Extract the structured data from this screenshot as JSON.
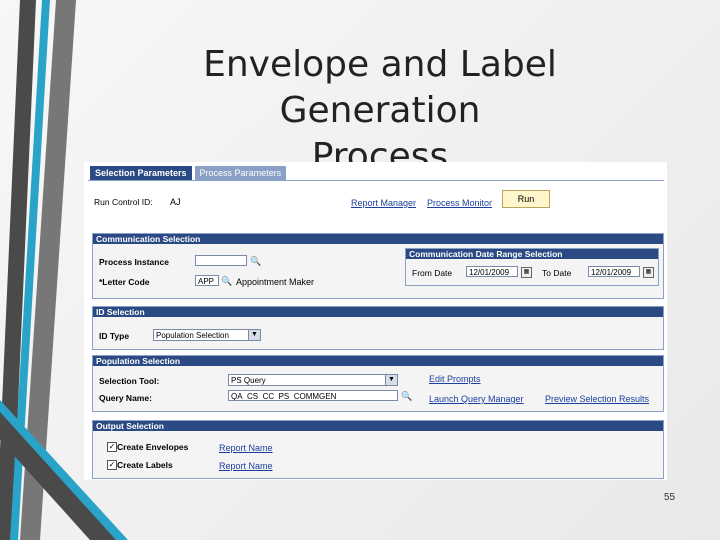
{
  "slide": {
    "title_line1": "Envelope and Label Generation",
    "title_line2": "Process",
    "page_number": "55"
  },
  "tabs": [
    {
      "label": "Selection Parameters",
      "active": true
    },
    {
      "label": "Process Parameters",
      "active": false
    }
  ],
  "header": {
    "run_control_label": "Run Control ID:",
    "run_control_value": "AJ",
    "report_manager": "Report Manager",
    "process_monitor": "Process Monitor",
    "run_button": "Run"
  },
  "communication": {
    "title": "Communication Selection",
    "process_instance_label": "Process Instance",
    "process_instance_value": "",
    "letter_code_label": "*Letter Code",
    "letter_code_value": "APP",
    "letter_code_desc": "Appointment Maker",
    "date_range": {
      "title": "Communication Date Range Selection",
      "from_label": "From Date",
      "from_value": "12/01/2009",
      "to_label": "To Date",
      "to_value": "12/01/2009"
    }
  },
  "id_selection": {
    "title": "ID Selection",
    "id_type_label": "ID Type",
    "id_type_value": "Population Selection"
  },
  "population": {
    "title": "Population Selection",
    "tool_label": "Selection Tool:",
    "tool_value": "PS Query",
    "query_label": "Query Name:",
    "query_value": "QA_CS_CC_PS_COMMGEN",
    "edit_prompts": "Edit Prompts",
    "launch_query_manager": "Launch Query Manager",
    "preview_results": "Preview Selection Results"
  },
  "output": {
    "title": "Output Selection",
    "envelopes_label": "Create Envelopes",
    "envelopes_checked": true,
    "envelopes_report": "Report Name",
    "labels_label": "Create Labels",
    "labels_checked": true,
    "labels_report": "Report Name"
  },
  "colors": {
    "header_blue": "#2b4a83",
    "tab_inactive": "#8aa0c6",
    "link": "#1b3f9c",
    "deco_dark": "#3a3a3a",
    "deco_cyan": "#2aa3c9"
  }
}
